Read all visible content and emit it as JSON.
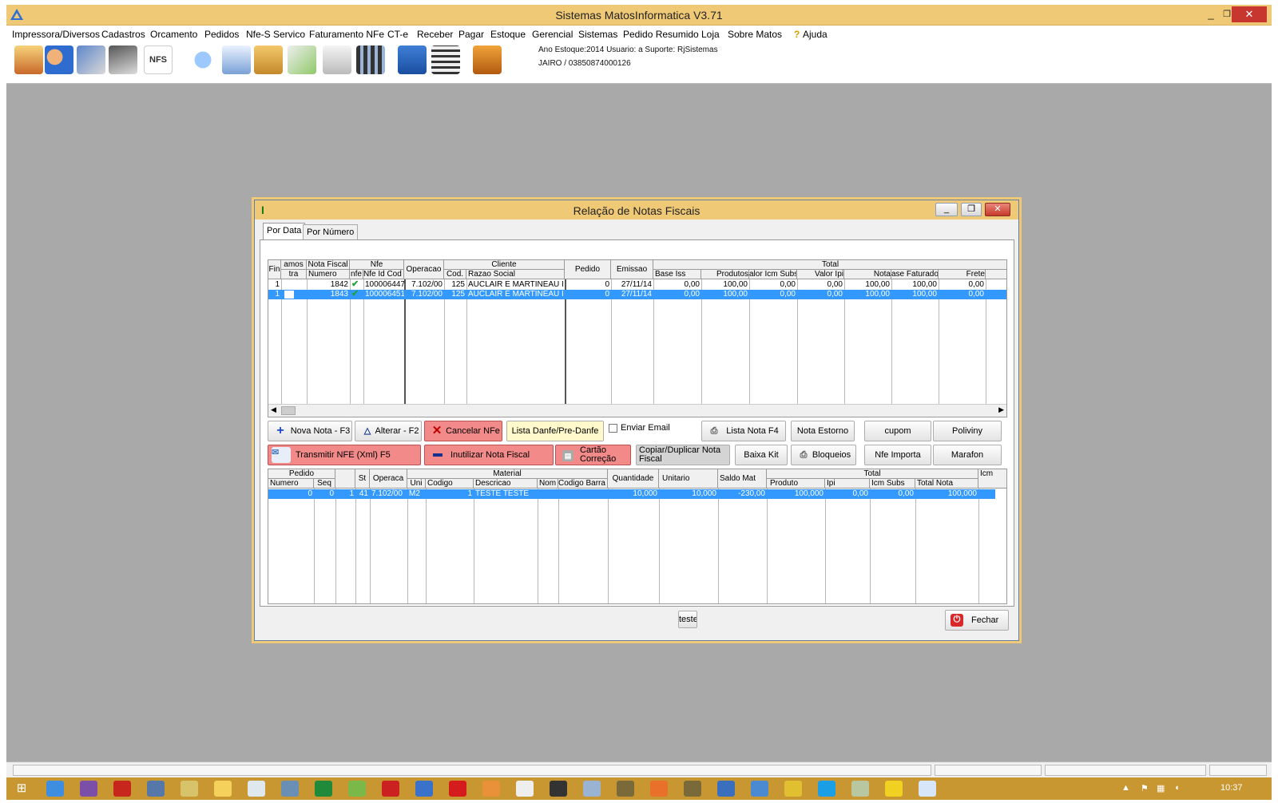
{
  "app": {
    "title": "Sistemas MatosInformatica V3.71",
    "menu": [
      "Impressora/Diversos",
      "Cadastros",
      "Orcamento",
      "Pedidos",
      "Nfe-S Servico",
      "Faturamento NFe",
      "CT-e",
      "Receber",
      "Pagar",
      "Estoque",
      "Gerencial",
      "Sistemas",
      "Pedido Resumido",
      "Loja",
      "Sobre Matos",
      "Ajuda"
    ],
    "info_line1": "Ano Estoque:2014 Usuario: a Suporte: RjSistemas",
    "info_line2": "JAIRO / 03850874000126",
    "nfs_icon_text": "NFS",
    "window_controls": {
      "minimize": "_",
      "restore": "❐",
      "close": "✕"
    }
  },
  "dialog": {
    "title": "Relação de Notas Fiscais",
    "tabs": [
      "Por Data",
      "Por Número"
    ],
    "upper_grid": {
      "group_headers": {
        "nfe": "Nfe",
        "cliente": "Cliente",
        "total": "Total"
      },
      "headers": {
        "fin": "Fin",
        "amostra_1": "amos",
        "amostra_2": "tra",
        "nota_fiscal": "Nota Fiscal",
        "numero": "Numero",
        "nfe_flag": "nfe",
        "nfe_id": "Nfe Id Cod",
        "operacao": "Operacao",
        "cod": "Cod.",
        "razao": "Razao Social",
        "pedido": "Pedido",
        "emissao": "Emissao",
        "base_iss": "Base Iss",
        "produtos": "Produtos",
        "icm_subs": "alor Icm Subs",
        "valor_ipi": "Valor Ipi",
        "nota": "Nota",
        "base_faturado": "ase Faturado",
        "frete": "Frete"
      },
      "rows": [
        {
          "fin": "1",
          "numero": "1842",
          "nfe_id": "100006447",
          "operacao": "7.102/00",
          "cod": "125",
          "razao": "AUCLAIR E MARTINEAU I",
          "pedido": "0",
          "emissao": "27/11/14",
          "base_iss": "0,00",
          "produtos": "100,00",
          "icm_subs": "0,00",
          "valor_ipi": "0,00",
          "nota": "100,00",
          "base_faturado": "100,00",
          "frete": "0,00",
          "selected": false
        },
        {
          "fin": "1",
          "numero": "1843",
          "nfe_id": "100006451",
          "operacao": "7.102/00",
          "cod": "125",
          "razao": "AUCLAIR E MARTINEAU I",
          "pedido": "0",
          "emissao": "27/11/14",
          "base_iss": "0,00",
          "produtos": "100,00",
          "icm_subs": "0,00",
          "valor_ipi": "0,00",
          "nota": "100,00",
          "base_faturado": "100,00",
          "frete": "0,00",
          "selected": true
        }
      ]
    },
    "buttons": {
      "nova_nota": "Nova Nota - F3",
      "alterar": "Alterar - F2",
      "cancelar": "Cancelar NFe",
      "lista_danfe": "Lista Danfe/Pre-Danfe",
      "enviar_email": "Enviar Email",
      "lista_nota": "Lista Nota F4",
      "nota_estorno": "Nota Estorno",
      "cupom": "cupom",
      "poliviny": "Poliviny",
      "transmitir": "Transmitir NFE (Xml) F5",
      "inutilizar": "Inutilizar Nota Fiscal",
      "cartao_correcao_1": "Cartão",
      "cartao_correcao_2": "Correção",
      "copiar_1": "Copiar/Duplicar Nota",
      "copiar_2": "Fiscal",
      "baixa_kit": "Baixa Kit",
      "bloqueios": "Bloqueios",
      "nfe_importa": "Nfe Importa",
      "marafon": "Marafon",
      "teste": "teste",
      "fechar": "Fechar"
    },
    "lower_grid": {
      "group_headers": {
        "pedido": "Pedido",
        "material": "Material",
        "total": "Total",
        "icm": "Icm"
      },
      "headers": {
        "numero": "Numero",
        "seq": "Seq",
        "st": "St",
        "operacao": "Operaca",
        "uni": "Uni",
        "codigo": "Codigo",
        "descricao": "Descricao",
        "nom": "Nom",
        "codigo_barra": "Codigo Barra",
        "quantidade": "Quantidade",
        "unitario": "Unitario",
        "saldo_mat": "Saldo Mat",
        "produto": "Produto",
        "ipi": "Ipi",
        "icm_subs": "Icm Subs",
        "total_nota": "Total Nota"
      },
      "rows": [
        {
          "numero": "0",
          "seq": "0",
          "st": "1",
          "st2": "41",
          "operacao": "7.102/00",
          "uni": "M2",
          "codigo": "1",
          "descricao": "TESTE TESTE",
          "quantidade": "10,000",
          "unitario": "10,000",
          "saldo_mat": "-230,00",
          "produto": "100,000",
          "ipi": "0,00",
          "icm_subs": "0,00",
          "total_nota": "100,000",
          "selected": true
        }
      ]
    }
  },
  "taskbar": {
    "clock": "10:37"
  },
  "colors": {
    "title_bar": "#f0c977",
    "selection": "#3399ff",
    "red_button": "#f28a8a",
    "desktop": "#a9a9a9",
    "taskbar": "#c99732"
  }
}
